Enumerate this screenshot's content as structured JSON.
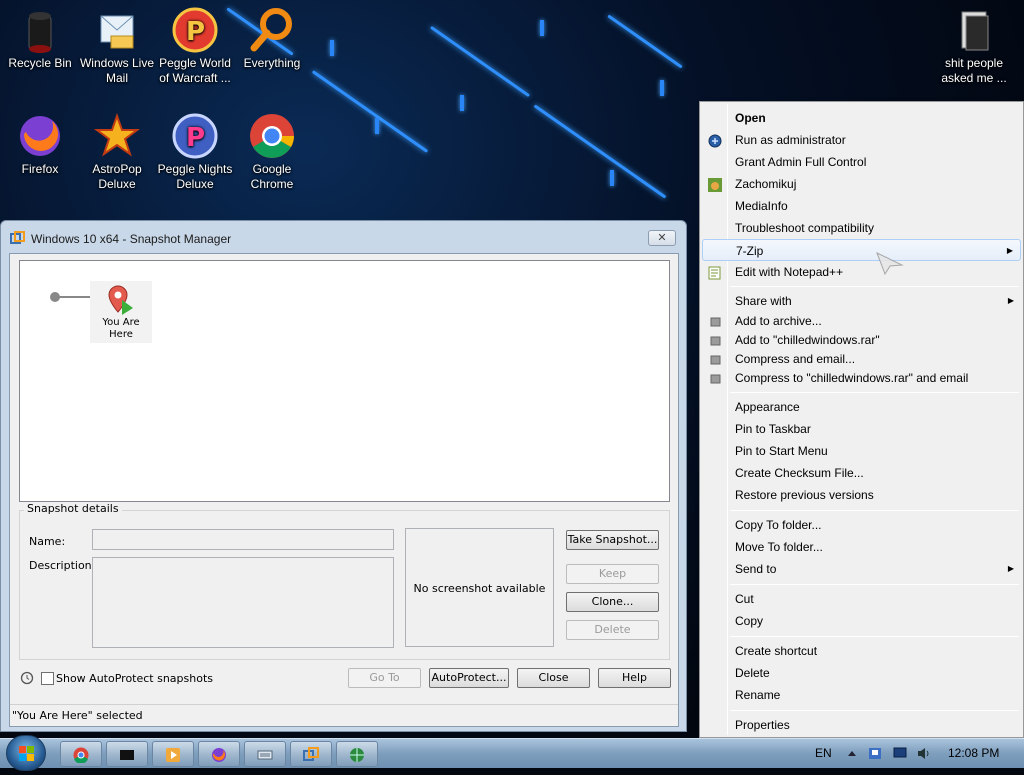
{
  "desktop": {
    "icons": [
      {
        "label": "Recycle Bin",
        "icon": "recycle-bin-icon"
      },
      {
        "label": "Windows Live Mail",
        "icon": "mail-icon"
      },
      {
        "label": "Peggle World of Warcraft ...",
        "icon": "peggle-icon"
      },
      {
        "label": "Everything",
        "icon": "magnifier-icon"
      },
      {
        "label": "Firefox",
        "icon": "firefox-icon"
      },
      {
        "label": "AstroPop Deluxe",
        "icon": "astropop-icon"
      },
      {
        "label": "Peggle Nights Deluxe",
        "icon": "peggle-icon"
      },
      {
        "label": "Google Chrome",
        "icon": "chrome-icon"
      },
      {
        "label": "shit people asked me ...",
        "icon": "folder-icon"
      }
    ]
  },
  "window": {
    "title": "Windows 10 x64 - Snapshot Manager",
    "close_label": "✕",
    "node_label": "You Are Here",
    "details_group": "Snapshot details",
    "name_label": "Name:",
    "description_label": "Description:",
    "screenshot_text": "No screenshot available",
    "buttons": {
      "take_snapshot": "Take Snapshot...",
      "keep": "Keep",
      "clone": "Clone...",
      "delete": "Delete",
      "go_to": "Go To",
      "autoprotect": "AutoProtect...",
      "close": "Close",
      "help": "Help"
    },
    "show_autoprotect": "Show AutoProtect snapshots",
    "status": "\"You Are Here\" selected"
  },
  "context_menu": {
    "items": [
      {
        "label": "Open",
        "bold": true
      },
      {
        "label": "Run as administrator",
        "icon": "shield-icon"
      },
      {
        "label": "Grant Admin Full Control"
      },
      {
        "label": "Zachomikuj",
        "icon": "hamster-icon"
      },
      {
        "label": "MediaInfo"
      },
      {
        "label": "Troubleshoot compatibility"
      },
      {
        "label": "7-Zip",
        "submenu": true,
        "highlighted": true
      },
      {
        "label": "Edit with Notepad++",
        "icon": "notepad-icon"
      },
      {
        "label": "Share with",
        "submenu": true
      },
      {
        "label": "Add to archive...",
        "icon": "winrar-icon"
      },
      {
        "label": "Add to \"chilledwindows.rar\"",
        "icon": "winrar-icon"
      },
      {
        "label": "Compress and email...",
        "icon": "winrar-icon"
      },
      {
        "label": "Compress to \"chilledwindows.rar\" and email",
        "icon": "winrar-icon"
      },
      {
        "label": "Appearance"
      },
      {
        "label": "Pin to Taskbar"
      },
      {
        "label": "Pin to Start Menu"
      },
      {
        "label": "Create Checksum File..."
      },
      {
        "label": "Restore previous versions"
      },
      {
        "label": "Copy To folder..."
      },
      {
        "label": "Move To folder..."
      },
      {
        "label": "Send to",
        "submenu": true
      },
      {
        "label": "Cut"
      },
      {
        "label": "Copy"
      },
      {
        "label": "Create shortcut"
      },
      {
        "label": "Delete"
      },
      {
        "label": "Rename"
      },
      {
        "label": "Properties"
      }
    ]
  },
  "taskbar": {
    "language": "EN",
    "clock": "12:08 PM",
    "pinned": [
      "chrome-icon",
      "terminal-icon",
      "media-player-icon",
      "firefox-icon",
      "keyboard-icon",
      "vmware-icon",
      "network-globe-icon"
    ]
  }
}
